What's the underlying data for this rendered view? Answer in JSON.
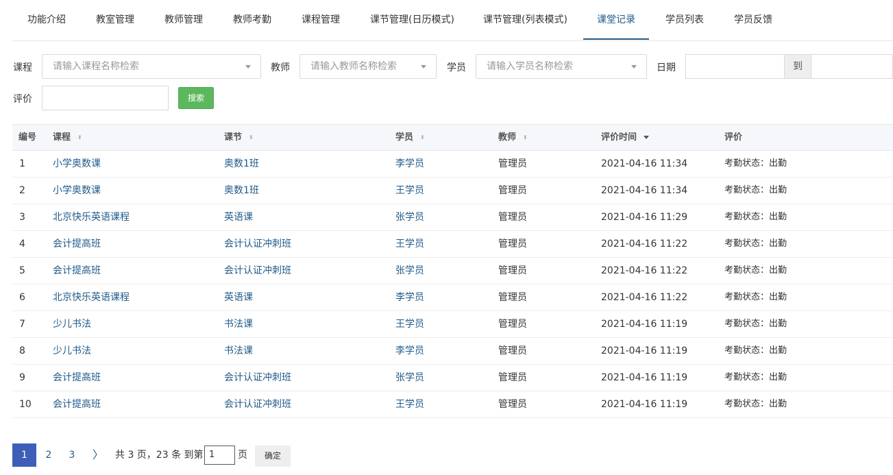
{
  "tabs": [
    {
      "label": "功能介绍"
    },
    {
      "label": "教室管理"
    },
    {
      "label": "教师管理"
    },
    {
      "label": "教师考勤"
    },
    {
      "label": "课程管理"
    },
    {
      "label": "课节管理(日历模式)"
    },
    {
      "label": "课节管理(列表模式)"
    },
    {
      "label": "课堂记录",
      "active": true
    },
    {
      "label": "学员列表"
    },
    {
      "label": "学员反馈"
    }
  ],
  "filters": {
    "course_label": "课程",
    "course_placeholder": "请输入课程名称检索",
    "teacher_label": "教师",
    "teacher_placeholder": "请输入教师名称检索",
    "student_label": "学员",
    "student_placeholder": "请输入学员名称检索",
    "date_label": "日期",
    "date_to": "到",
    "rating_label": "评价",
    "rating_value": "",
    "search_button": "搜索"
  },
  "table": {
    "headers": {
      "id": "编号",
      "course": "课程",
      "lesson": "课节",
      "student": "学员",
      "teacher": "教师",
      "time": "评价时间",
      "rating": "评价"
    },
    "rows": [
      {
        "id": "1",
        "course": "小学奥数课",
        "lesson": "奥数1班",
        "student": "李学员",
        "teacher": "管理员",
        "time": "2021-04-16 11:34",
        "rating": "考勤状态：出勤"
      },
      {
        "id": "2",
        "course": "小学奥数课",
        "lesson": "奥数1班",
        "student": "王学员",
        "teacher": "管理员",
        "time": "2021-04-16 11:34",
        "rating": "考勤状态：出勤"
      },
      {
        "id": "3",
        "course": "北京快乐英语课程",
        "lesson": "英语课",
        "student": "张学员",
        "teacher": "管理员",
        "time": "2021-04-16 11:29",
        "rating": "考勤状态：出勤"
      },
      {
        "id": "4",
        "course": "会计提高班",
        "lesson": "会计认证冲刺班",
        "student": "王学员",
        "teacher": "管理员",
        "time": "2021-04-16 11:22",
        "rating": "考勤状态：出勤"
      },
      {
        "id": "5",
        "course": "会计提高班",
        "lesson": "会计认证冲刺班",
        "student": "张学员",
        "teacher": "管理员",
        "time": "2021-04-16 11:22",
        "rating": "考勤状态：出勤"
      },
      {
        "id": "6",
        "course": "北京快乐英语课程",
        "lesson": "英语课",
        "student": "李学员",
        "teacher": "管理员",
        "time": "2021-04-16 11:22",
        "rating": "考勤状态：出勤"
      },
      {
        "id": "7",
        "course": "少儿书法",
        "lesson": "书法课",
        "student": "王学员",
        "teacher": "管理员",
        "time": "2021-04-16 11:19",
        "rating": "考勤状态：出勤"
      },
      {
        "id": "8",
        "course": "少儿书法",
        "lesson": "书法课",
        "student": "李学员",
        "teacher": "管理员",
        "time": "2021-04-16 11:19",
        "rating": "考勤状态：出勤"
      },
      {
        "id": "9",
        "course": "会计提高班",
        "lesson": "会计认证冲刺班",
        "student": "张学员",
        "teacher": "管理员",
        "time": "2021-04-16 11:19",
        "rating": "考勤状态：出勤"
      },
      {
        "id": "10",
        "course": "会计提高班",
        "lesson": "会计认证冲刺班",
        "student": "王学员",
        "teacher": "管理员",
        "time": "2021-04-16 11:19",
        "rating": "考勤状态：出勤"
      }
    ]
  },
  "pagination": {
    "current": "1",
    "pages": [
      "2",
      "3"
    ],
    "next_symbol": "〉",
    "summary": "共 3 页，23 条 到第",
    "goto_value": "1",
    "page_suffix": "页",
    "confirm": "确定"
  },
  "colors": {
    "link": "#1f5a8a",
    "search_button": "#5cb85c",
    "pager_current": "#3d5fb8"
  }
}
